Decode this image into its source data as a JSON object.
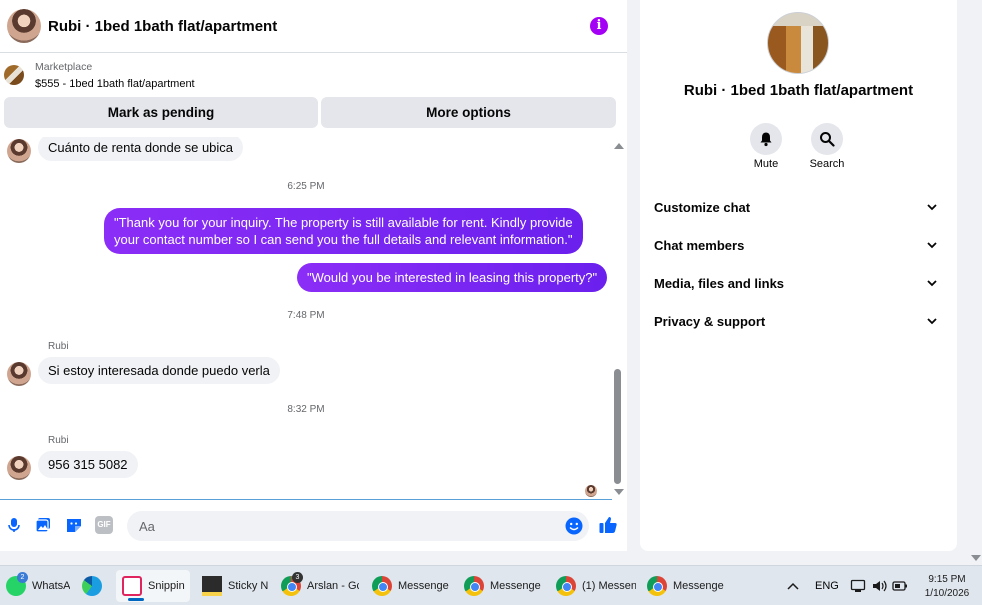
{
  "chat": {
    "title": "Rubi · 1bed 1bath flat/apartment",
    "listing": {
      "source": "Marketplace",
      "price_title": "$555 - 1bed 1bath flat/apartment"
    },
    "actions": {
      "pending_label": "Mark as pending",
      "more_label": "More options"
    },
    "messages": {
      "m1_text": "Cuánto de renta donde se ubica",
      "t1": "6:25 PM",
      "m2_line1": "\"Thank you for your inquiry. The property is still available for rent. Kindly provide",
      "m2_line2": "your contact number so I can send you the full details and relevant information.\"",
      "m3_text": "\"Would you be interested in leasing this property?\"",
      "t2": "7:48 PM",
      "sender1": "Rubi",
      "m4_text": "Si estoy interesada donde puedo verla",
      "t3": "8:32 PM",
      "sender2": "Rubi",
      "m5_text": "956 315 5082"
    },
    "composer": {
      "placeholder": "Aa",
      "gif_label": "GIF"
    }
  },
  "info": {
    "title": "Rubi · 1bed 1bath flat/apartment",
    "mute_label": "Mute",
    "search_label": "Search",
    "sections": {
      "customize": "Customize chat",
      "members": "Chat members",
      "media": "Media, files and links",
      "privacy": "Privacy & support"
    }
  },
  "taskbar": {
    "whatsapp": "WhatsA",
    "whatsapp_badge": "2",
    "snipping": "Snippin",
    "sticky": "Sticky N",
    "arslan": "Arslan - Gc",
    "arslan_badge": "3",
    "messenger1": "Messenge",
    "messenger2": "Messenge",
    "messenger3": "(1) Messen",
    "messenger4": "Messenge",
    "lang": "ENG",
    "time": "9:15 PM",
    "date": "1/10/2026"
  },
  "colors": {
    "accent": "#a400f5",
    "outgoing_bubble": "#7a1cf2",
    "icon_blue": "#0866ff"
  }
}
